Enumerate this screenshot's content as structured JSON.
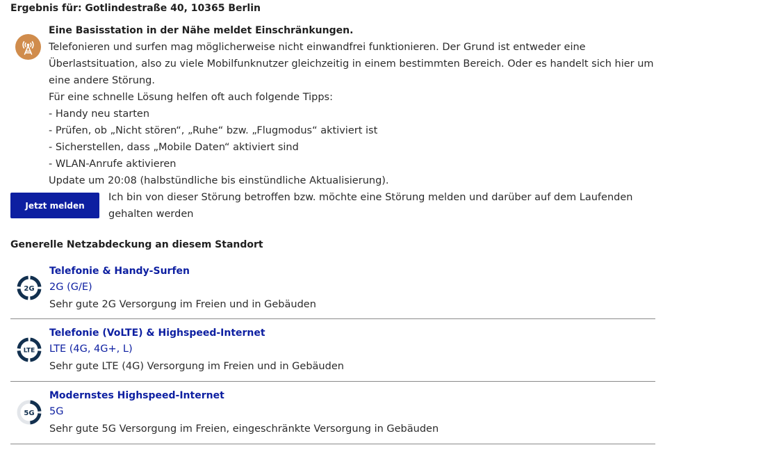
{
  "result": {
    "title": "Ergebnis für: Gotlindestraße 40, 10365 Berlin"
  },
  "alert": {
    "icon": "antenna-icon",
    "icon_color": "#d08c4c",
    "heading": "Eine Basisstation in der Nähe meldet Einschränkungen.",
    "paragraph": "Telefonieren und surfen mag möglicherweise nicht einwandfrei funktionieren. Der Grund ist entweder eine Überlastsituation, also zu viele Mobilfunknutzer gleichzeitig in einem bestimmten Bereich. Oder es handelt sich hier um eine andere Störung.",
    "tips_intro": "Für eine schnelle Lösung helfen oft auch folgende Tipps:",
    "tips": [
      "- Handy neu starten",
      "- Prüfen, ob „Nicht stören“, „Ruhe“ bzw. „Flugmodus“ aktiviert ist",
      "- Sicherstellen, dass „Mobile Daten“ aktiviert sind",
      "- WLAN-Anrufe aktivieren"
    ],
    "update": "Update um 20:08 (halbstündliche bis einstündliche Aktualisierung)."
  },
  "report": {
    "button_label": "Jetzt melden",
    "button_color": "#0d1fa1",
    "text": "Ich bin von dieser Störung betroffen bzw. möchte eine Störung melden und darüber auf dem Laufenden gehalten werden"
  },
  "coverage": {
    "title": "Generelle Netzabdeckung an diesem Standort",
    "accent_color": "#0d1fa1",
    "items": [
      {
        "icon": "2g-signal-icon",
        "badge": "2G",
        "title": "Telefonie & Handy-Surfen",
        "tech": "2G (G/E)",
        "description": "Sehr gute 2G Versorgung im Freien und in Gebäuden",
        "quality_segments": 4
      },
      {
        "icon": "lte-signal-icon",
        "badge": "LTE",
        "title": "Telefonie (VoLTE) & Highspeed-Internet",
        "tech": "LTE (4G, 4G+, L)",
        "description": "Sehr gute LTE (4G) Versorgung im Freien und in Gebäuden",
        "quality_segments": 4
      },
      {
        "icon": "5g-signal-icon",
        "badge": "5G",
        "title": "Modernstes Highspeed-Internet",
        "tech": "5G",
        "description": "Sehr gute 5G Versorgung im Freien, eingeschränkte Versorgung in Gebäuden",
        "quality_segments": 2
      }
    ]
  }
}
